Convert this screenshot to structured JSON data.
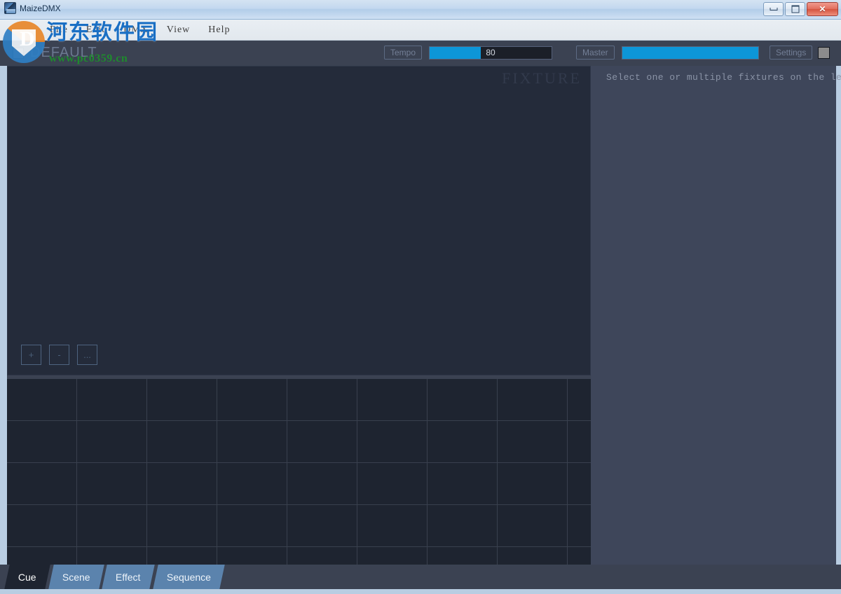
{
  "window": {
    "title": "MaizeDMX",
    "icon": "app-icon",
    "controls": {
      "minimize": "minimize-icon",
      "maximize": "maximize-icon",
      "close": "✕"
    }
  },
  "menubar": {
    "items": [
      {
        "label": "File"
      },
      {
        "label": "Edit"
      },
      {
        "label": "DMX"
      },
      {
        "label": "View"
      },
      {
        "label": "Help"
      }
    ]
  },
  "toolbar": {
    "project_label": "DEFAULT",
    "project_checkbox_checked": false,
    "tempo": {
      "label": "Tempo",
      "value": "80",
      "fill_percent": 42
    },
    "master": {
      "label": "Master",
      "value": "",
      "fill_percent": 100
    },
    "settings_label": "Settings",
    "blackout_button": "blackout-swatch"
  },
  "fixture_panel": {
    "watermark_label": "FIXTURE",
    "buttons": [
      {
        "label": "+",
        "name": "add-fixture-button"
      },
      {
        "label": "-",
        "name": "remove-fixture-button"
      },
      {
        "label": "...",
        "name": "more-fixture-options-button"
      }
    ]
  },
  "info_panel": {
    "hint": "Select one or multiple fixtures on the left"
  },
  "cue_grid": {
    "columns": 9,
    "rows": 5,
    "cells": [
      "",
      "",
      "",
      "",
      "",
      "",
      "",
      "",
      "",
      "",
      "",
      "",
      "",
      "",
      "",
      "",
      "",
      "",
      "",
      "",
      "",
      "",
      "",
      "",
      "",
      "",
      "",
      "",
      "",
      "",
      "",
      "",
      "",
      "",
      "",
      "",
      "",
      "",
      "",
      "",
      "",
      "",
      "",
      "",
      ""
    ]
  },
  "bottom_tabs": {
    "active": "Cue",
    "items": [
      {
        "label": "Cue",
        "active": true
      },
      {
        "label": "Scene",
        "active": false
      },
      {
        "label": "Effect",
        "active": false
      },
      {
        "label": "Sequence",
        "active": false
      }
    ]
  },
  "watermark": {
    "site_cn": "河东软件园",
    "site_url": "www.pc0359.cn",
    "logo_letter": "D"
  },
  "colors": {
    "accent_blue": "#0d96d8",
    "panel_dark": "#242b3a",
    "toolbar_bg": "#3b4252",
    "info_bg": "#3e465a",
    "grid_bg": "#1e2430",
    "tab_inactive": "#5b83ad",
    "window_edge": "#b9cde2"
  }
}
